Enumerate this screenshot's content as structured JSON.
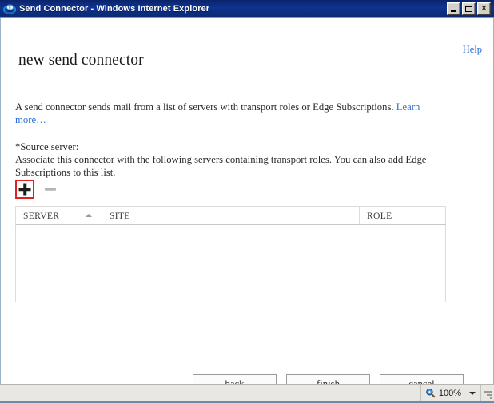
{
  "window": {
    "title": "Send Connector - Windows Internet Explorer",
    "app_icon": "internet-explorer-icon",
    "controls": {
      "minimize": "minimize-icon",
      "maximize": "maximize-icon",
      "close": "×"
    }
  },
  "page": {
    "heading": "new send connector",
    "help_label": "Help",
    "intro_text": "A send connector sends mail from a list of servers with transport roles or Edge Subscriptions. ",
    "intro_link": "Learn more…",
    "source_server_label": "*Source server:",
    "source_server_description": "Associate this connector with the following servers containing transport roles. You can also add Edge Subscriptions to this list."
  },
  "toolbar": {
    "add_label": "+",
    "add_icon": "plus-icon",
    "remove_label": "−",
    "remove_icon": "minus-icon",
    "add_focused": true,
    "remove_disabled": true,
    "focus_color": "#e02020"
  },
  "grid": {
    "columns": [
      {
        "key": "server",
        "label": "SERVER",
        "sorted": "asc"
      },
      {
        "key": "site",
        "label": "SITE",
        "sorted": "none"
      },
      {
        "key": "role",
        "label": "ROLE",
        "sorted": "none"
      }
    ],
    "rows": []
  },
  "footer": {
    "buttons": [
      {
        "name": "back-button",
        "label": "back"
      },
      {
        "name": "finish-button",
        "label": "finish"
      },
      {
        "name": "cancel-button",
        "label": "cancel"
      }
    ]
  },
  "statusbar": {
    "zoom_level": "100%",
    "zoom_icon": "magnifier-icon",
    "resize_grip": "resize-grip-icon"
  },
  "colors": {
    "titlebar_start": "#0a246a",
    "titlebar_end": "#0a2a72",
    "link": "#2a6ed6",
    "focus_red": "#e02020",
    "statusbar": "#e8e7e3",
    "grid_border": "#dcdcdc"
  }
}
